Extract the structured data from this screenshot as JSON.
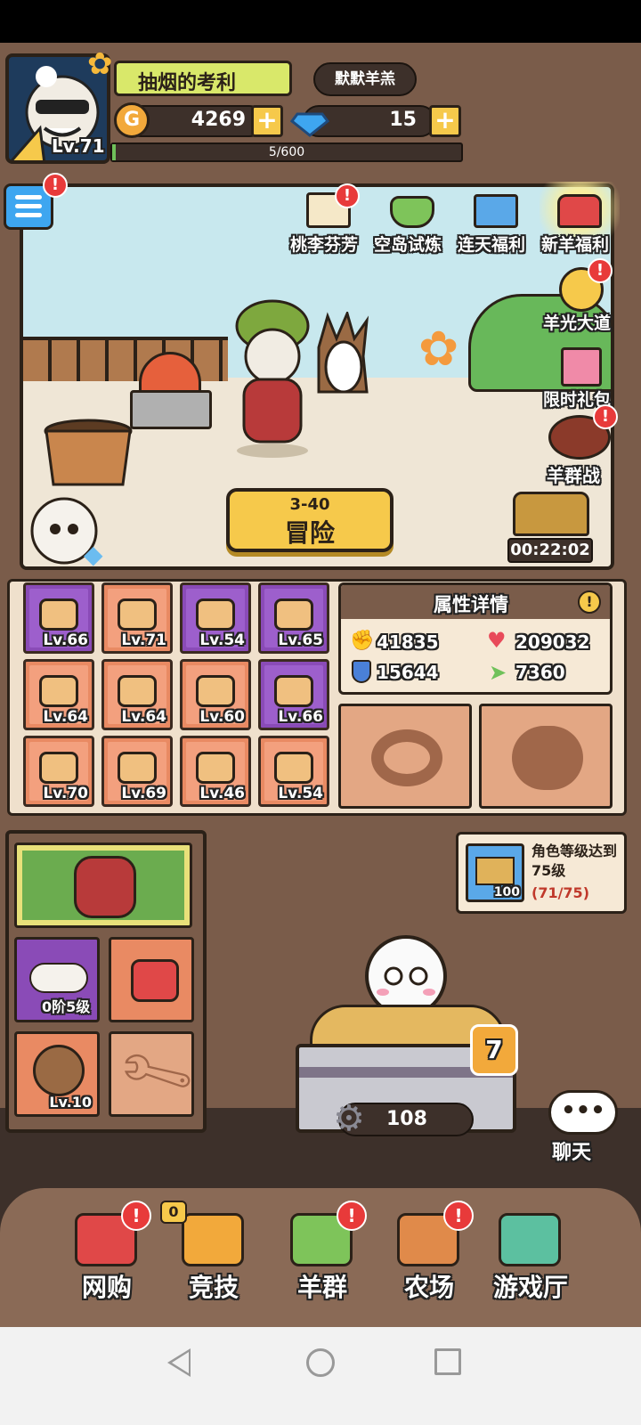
{
  "player": {
    "name": "抽烟的考利",
    "level": "Lv.71",
    "guild": "默默羊羔",
    "gold": "4269",
    "gems": "15",
    "exp": "5/600"
  },
  "events": [
    {
      "label": "桃李芬芳",
      "badge": "!"
    },
    {
      "label": "空岛试炼",
      "badge": ""
    },
    {
      "label": "连天福利",
      "badge": ""
    },
    {
      "label": "新羊福利",
      "badge": ""
    }
  ],
  "side_events": [
    {
      "label": "羊光大道",
      "badge": "!"
    },
    {
      "label": "限时礼包",
      "badge": ""
    },
    {
      "label": "羊群战",
      "badge": "!"
    }
  ],
  "adventure": {
    "stage": "3-40",
    "label": "冒险"
  },
  "timer": "00:22:02",
  "equipment": [
    {
      "level": "Lv.66",
      "rarity": "purple",
      "icon": "helmet-icon"
    },
    {
      "level": "Lv.71",
      "rarity": "orange",
      "icon": "lollipop-icon"
    },
    {
      "level": "Lv.54",
      "rarity": "purple",
      "icon": "bucket-icon"
    },
    {
      "level": "Lv.65",
      "rarity": "purple",
      "icon": "trough-icon"
    },
    {
      "level": "Lv.64",
      "rarity": "orange",
      "icon": "scarecrow-icon"
    },
    {
      "level": "Lv.64",
      "rarity": "orange",
      "icon": "crate-icon"
    },
    {
      "level": "Lv.60",
      "rarity": "orange",
      "icon": "flower-icon"
    },
    {
      "level": "Lv.66",
      "rarity": "purple",
      "icon": "bush-icon"
    },
    {
      "level": "Lv.70",
      "rarity": "orange",
      "icon": "mushroom-icon"
    },
    {
      "level": "Lv.69",
      "rarity": "orange",
      "icon": "signboard-icon"
    },
    {
      "level": "Lv.46",
      "rarity": "orange",
      "icon": "pitchfork-icon"
    },
    {
      "level": "Lv.54",
      "rarity": "orange",
      "icon": "gate-icon"
    }
  ],
  "attributes": {
    "title": "属性详情",
    "attack": "41835",
    "hp": "209032",
    "defense": "15644",
    "speed": "7360"
  },
  "quest": {
    "text": "角色等级达到75级",
    "progress": "(71/75)",
    "reward": "100"
  },
  "pets": {
    "cloud_stage": "0阶5级",
    "hedgehog_level": "Lv.10"
  },
  "hay": {
    "level": "7",
    "count": "108"
  },
  "chat": "聊天",
  "nav": [
    {
      "label": "网购",
      "badge": "!",
      "icon": "basket-icon"
    },
    {
      "label": "竞技",
      "badge": "0",
      "icon": "trophy-icon"
    },
    {
      "label": "羊群",
      "badge": "!",
      "icon": "sheep-flock-icon"
    },
    {
      "label": "农场",
      "badge": "!",
      "icon": "barn-icon"
    },
    {
      "label": "游戏厅",
      "badge": "",
      "icon": "arcade-icon"
    }
  ],
  "colors": {
    "panel_brown": "#7a5c4a",
    "ground_dark": "#3d302a",
    "accent_yellow": "#f6c94b",
    "badge_red": "#e83a3a",
    "purple_rarity": "#8a4bb7",
    "orange_rarity": "#e98a63",
    "progress_red": "#c0392b"
  }
}
